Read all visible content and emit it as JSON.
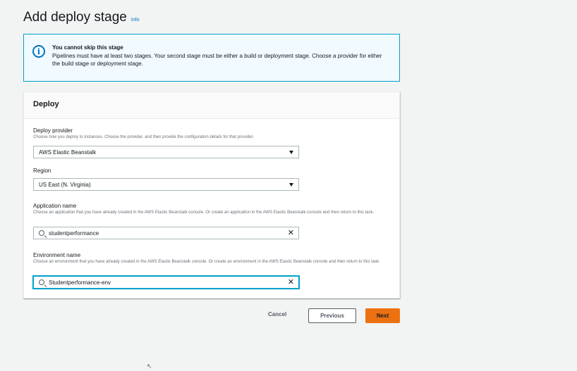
{
  "page": {
    "title": "Add deploy stage",
    "info_label": "Info"
  },
  "alert": {
    "icon": "info-icon",
    "title": "You cannot skip this stage",
    "body": "Pipelines must have at least two stages. Your second stage must be either a build or deployment stage. Choose a provider for either the build stage or deployment stage."
  },
  "panel": {
    "title": "Deploy",
    "deploy_provider": {
      "label": "Deploy provider",
      "description": "Choose how you deploy to instances. Choose the provider, and then provide the configuration details for that provider.",
      "value": "AWS Elastic Beanstalk"
    },
    "region": {
      "label": "Region",
      "value": "US East (N. Virginia)"
    },
    "application_name": {
      "label": "Application name",
      "description": "Choose an application that you have already created in the AWS Elastic Beanstalk console. Or create an application in the AWS Elastic Beanstalk console and then return to this task.",
      "value": "studentperformance"
    },
    "environment_name": {
      "label": "Environment name",
      "description": "Choose an environment that you have already created in the AWS Elastic Beanstalk console. Or create an environment in the AWS Elastic Beanstalk console and then return to this task.",
      "value": "Studentperformance-env"
    }
  },
  "actions": {
    "cancel": "Cancel",
    "previous": "Previous",
    "next": "Next"
  },
  "colors": {
    "primary_button": "#ec7211",
    "info_border": "#00a1c9",
    "info_bg": "#f1faff",
    "link": "#0073bb"
  }
}
